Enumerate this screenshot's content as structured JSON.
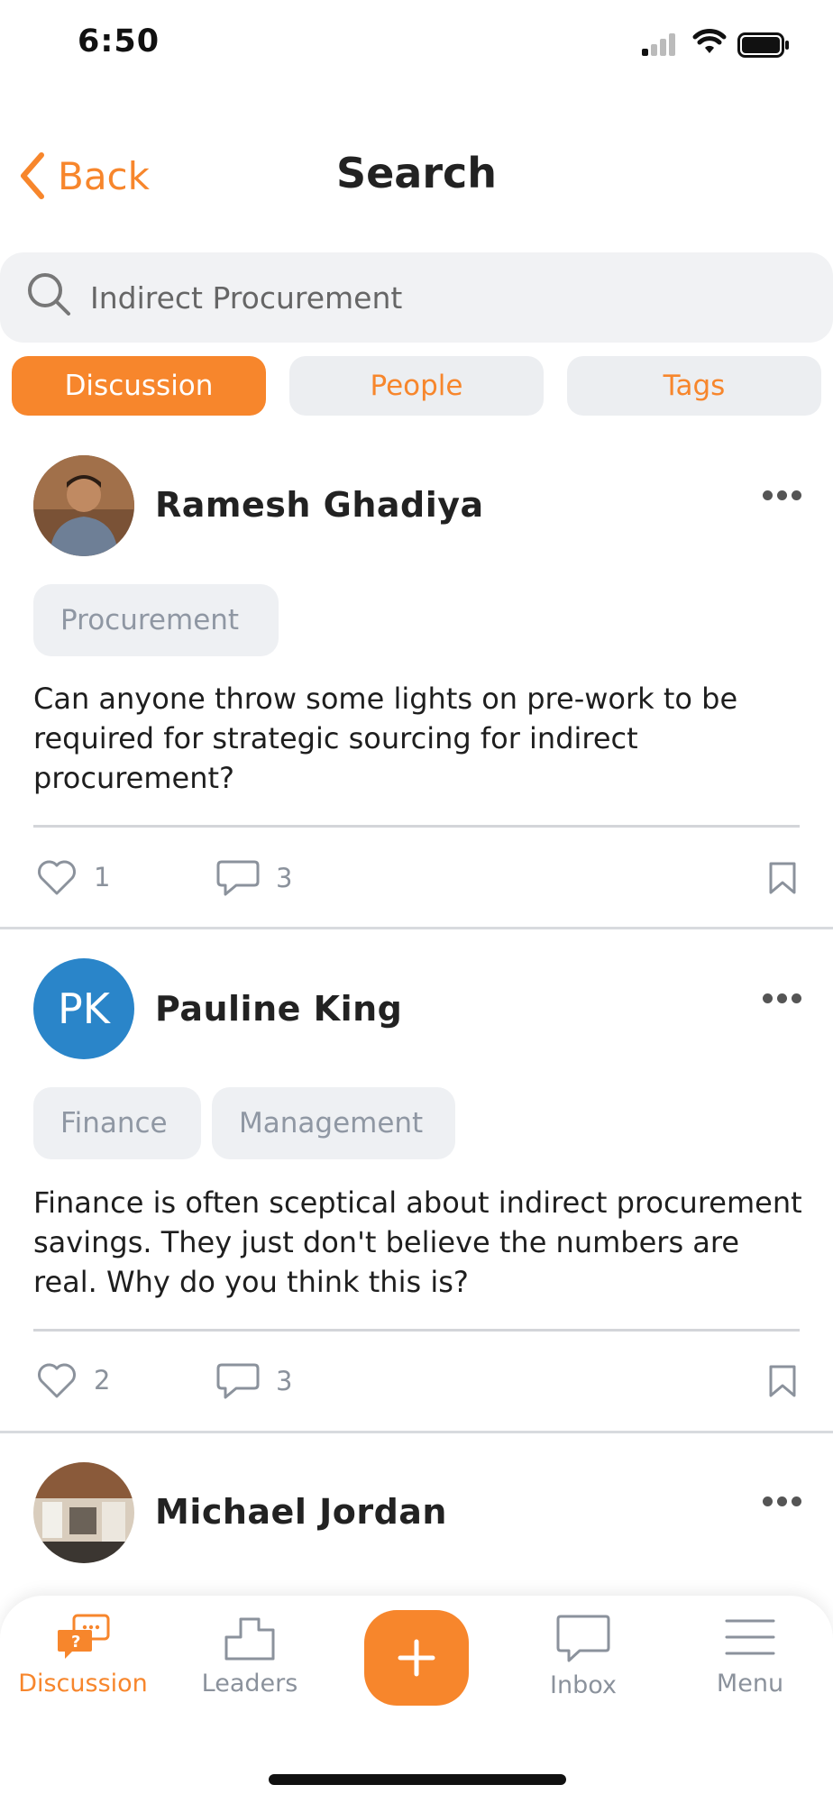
{
  "status_bar": {
    "time": "6:50"
  },
  "nav": {
    "back_label": "Back",
    "title": "Search"
  },
  "search": {
    "value": "Indirect Procurement"
  },
  "tabs": [
    {
      "label": "Discussion",
      "active": true
    },
    {
      "label": "People",
      "active": false
    },
    {
      "label": "Tags",
      "active": false
    }
  ],
  "posts": [
    {
      "author": "Ramesh Ghadiya",
      "tags": [
        "Procurement"
      ],
      "text": "Can anyone throw some lights on pre-work to be required for strategic sourcing for indirect procurement?",
      "likes": "1",
      "comments": "3"
    },
    {
      "author": "Pauline King",
      "initials": "PK",
      "avatar_color": "#2a85c9",
      "tags": [
        "Finance",
        "Management"
      ],
      "text": "Finance is often sceptical about indirect procurement savings. They just don't believe the numbers are real. Why do you think this is?",
      "likes": "2",
      "comments": "3"
    },
    {
      "author": "Michael Jordan"
    }
  ],
  "tab_bar": [
    {
      "label": "Discussion",
      "icon": "discussion-icon",
      "active": true
    },
    {
      "label": "Leaders",
      "icon": "leaders-icon",
      "active": false
    },
    {
      "label": "",
      "icon": "plus-icon",
      "active": false
    },
    {
      "label": "Inbox",
      "icon": "inbox-icon",
      "active": false
    },
    {
      "label": "Menu",
      "icon": "menu-icon",
      "active": false
    }
  ],
  "colors": {
    "accent": "#f7862c",
    "muted": "#8b929c",
    "avatar_pk": "#2a85c9"
  }
}
